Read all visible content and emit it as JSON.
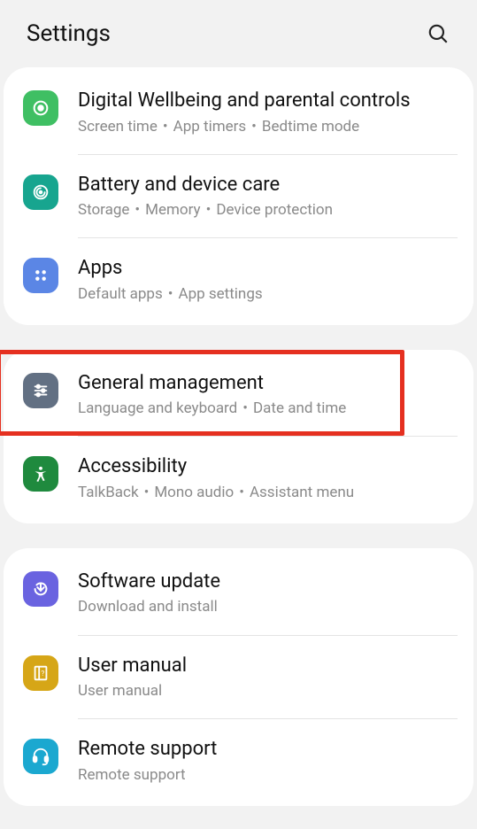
{
  "header": {
    "title": "Settings"
  },
  "groups": [
    {
      "items": [
        {
          "id": "digital-wellbeing",
          "title": "Digital Wellbeing and parental controls",
          "subtitle_parts": [
            "Screen time",
            "App timers",
            "Bedtime mode"
          ],
          "icon_bg": "#3fbf63",
          "icon": "wellbeing"
        },
        {
          "id": "battery-device-care",
          "title": "Battery and device care",
          "subtitle_parts": [
            "Storage",
            "Memory",
            "Device protection"
          ],
          "icon_bg": "#17a58f",
          "icon": "device-care"
        },
        {
          "id": "apps",
          "title": "Apps",
          "subtitle_parts": [
            "Default apps",
            "App settings"
          ],
          "icon_bg": "#5b86e5",
          "icon": "apps"
        }
      ]
    },
    {
      "items": [
        {
          "id": "general-management",
          "title": "General management",
          "subtitle_parts": [
            "Language and keyboard",
            "Date and time"
          ],
          "icon_bg": "#627083",
          "icon": "sliders",
          "highlighted": true
        },
        {
          "id": "accessibility",
          "title": "Accessibility",
          "subtitle_parts": [
            "TalkBack",
            "Mono audio",
            "Assistant menu"
          ],
          "icon_bg": "#1f8a3e",
          "icon": "accessibility"
        }
      ]
    },
    {
      "items": [
        {
          "id": "software-update",
          "title": "Software update",
          "subtitle_parts": [
            "Download and install"
          ],
          "icon_bg": "#6a63e0",
          "icon": "update"
        },
        {
          "id": "user-manual",
          "title": "User manual",
          "subtitle_parts": [
            "User manual"
          ],
          "icon_bg": "#d6a617",
          "icon": "manual"
        },
        {
          "id": "remote-support",
          "title": "Remote support",
          "subtitle_parts": [
            "Remote support"
          ],
          "icon_bg": "#1ba8d0",
          "icon": "support"
        }
      ]
    }
  ]
}
